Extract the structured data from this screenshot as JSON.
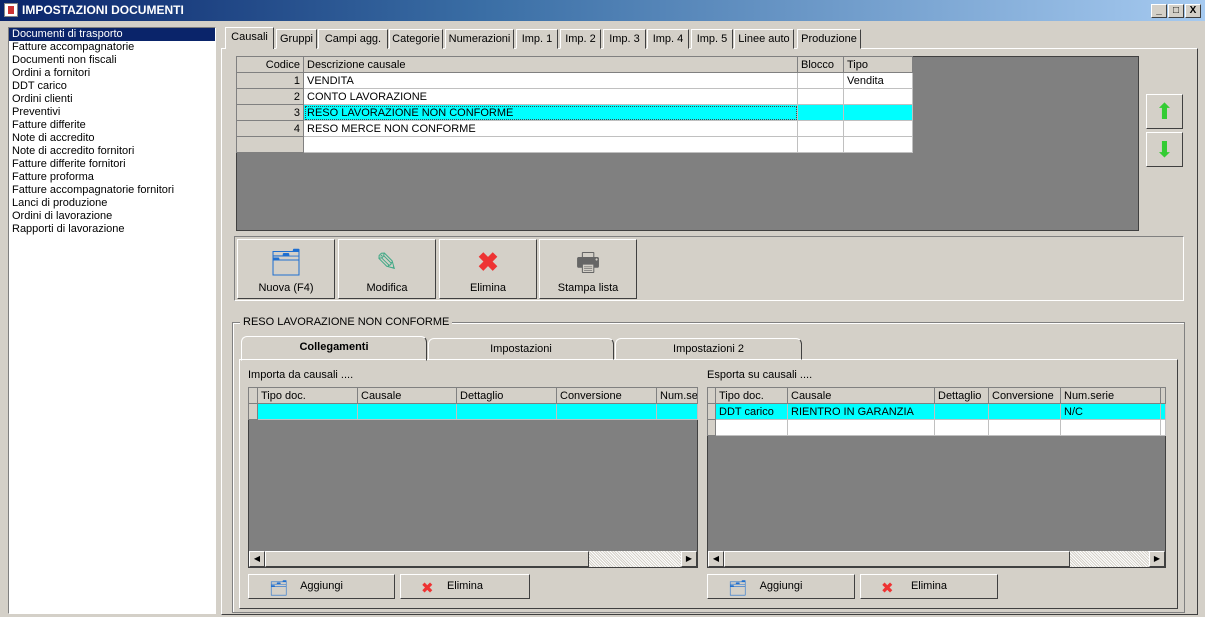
{
  "window": {
    "title": "IMPOSTAZIONI DOCUMENTI",
    "minimize": "_",
    "maximize": "□",
    "close": "X"
  },
  "sidebar": {
    "items": [
      "Documenti di trasporto",
      "Fatture accompagnatorie",
      "Documenti non fiscali",
      "Ordini a fornitori",
      "DDT carico",
      "Ordini clienti",
      "Preventivi",
      "Fatture differite",
      "Note di accredito",
      "Note di accredito fornitori",
      "Fatture differite fornitori",
      "Fatture proforma",
      "Fatture accompagnatorie fornitori",
      "Lanci di produzione",
      "Ordini di lavorazione",
      "Rapporti di lavorazione"
    ]
  },
  "tabs": [
    "Causali",
    "Gruppi",
    "Campi agg.",
    "Categorie",
    "Numerazioni",
    "Imp. 1",
    "Imp. 2",
    "Imp. 3",
    "Imp. 4",
    "Imp. 5",
    "Linee auto",
    "Produzione"
  ],
  "causali": {
    "headers": [
      "Codice",
      "Descrizione causale",
      "Blocco",
      "Tipo"
    ],
    "rows": [
      [
        "1",
        "VENDITA",
        "",
        "Vendita"
      ],
      [
        "2",
        "CONTO LAVORAZIONE",
        "",
        ""
      ],
      [
        "3",
        "RESO LAVORAZIONE NON CONFORME",
        "",
        ""
      ],
      [
        "4",
        "RESO MERCE NON CONFORME",
        "",
        ""
      ]
    ]
  },
  "toolbar": {
    "new": "Nuova (F4)",
    "edit": "Modifica",
    "delete": "Elimina",
    "print": "Stampa lista"
  },
  "detail": {
    "group_title": "RESO LAVORAZIONE NON CONFORME",
    "subtabs": [
      "Collegamenti",
      "Impostazioni",
      "Impostazioni 2"
    ],
    "import": {
      "label": "Importa da causali ....",
      "headers": [
        "Tipo doc.",
        "Causale",
        "Dettaglio",
        "Conversione",
        "Num.se"
      ],
      "add": "Aggiungi",
      "delete": "Elimina"
    },
    "export": {
      "label": "Esporta su causali ....",
      "headers": [
        "Tipo doc.",
        "Causale",
        "Dettaglio",
        "Conversione",
        "Num.serie"
      ],
      "rows": [
        [
          "DDT carico",
          "RIENTRO IN GARANZIA",
          "",
          "",
          "N/C"
        ]
      ],
      "add": "Aggiungi",
      "delete": "Elimina"
    }
  },
  "colors": {
    "selection": "#00ffff",
    "title_bar": "#0a246a",
    "grid_bg": "#808080"
  }
}
